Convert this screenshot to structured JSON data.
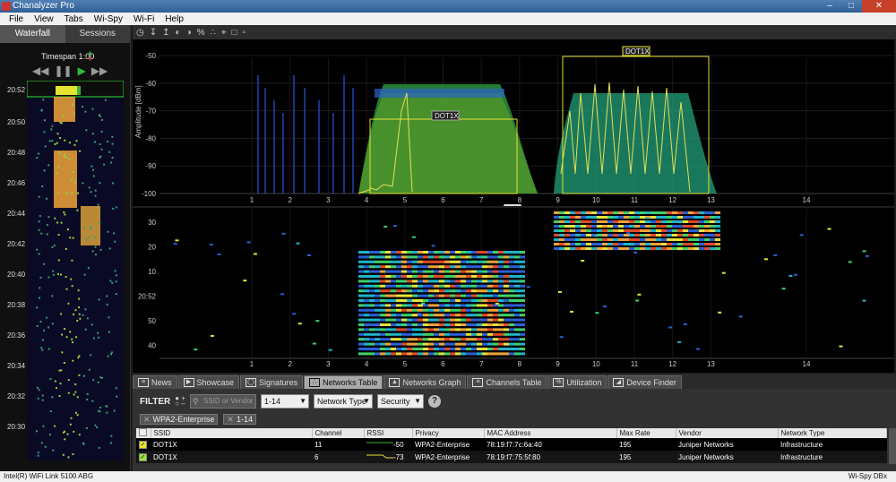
{
  "window": {
    "title": "Chanalyzer Pro"
  },
  "menu": [
    "File",
    "View",
    "Tabs",
    "Wi-Spy",
    "Wi-Fi",
    "Help"
  ],
  "left": {
    "tabs": [
      "Waterfall",
      "Sessions"
    ],
    "timespan": "Timespan 1:00",
    "times": [
      "20:52",
      "20:50",
      "20:48",
      "20:46",
      "20:44",
      "20:42",
      "20:40",
      "20:38",
      "20:36",
      "20:34",
      "20:32",
      "20:30"
    ]
  },
  "spectrum": {
    "ylabel": "Amplitude [dBm]",
    "yticks": [
      "-50",
      "-60",
      "-70",
      "-80",
      "-90",
      "-100"
    ],
    "xticks": [
      "1",
      "2",
      "3",
      "4",
      "5",
      "6",
      "7",
      "8",
      "9",
      "10",
      "11",
      "12",
      "13",
      "14"
    ],
    "networks": [
      {
        "label": "DOT1X"
      },
      {
        "label": "DOT1X"
      }
    ]
  },
  "waterfall": {
    "yticks": [
      "30",
      "20",
      "10",
      "20:52",
      "50",
      "40"
    ],
    "xticks": [
      "1",
      "2",
      "3",
      "4",
      "5",
      "6",
      "7",
      "8",
      "9",
      "10",
      "11",
      "12",
      "13",
      "14"
    ]
  },
  "bottom_tabs": [
    "News",
    "Showcase",
    "Signatures",
    "Networks Table",
    "Networks Graph",
    "Channels Table",
    "Utilization",
    "Device Finder"
  ],
  "filter": {
    "label": "FILTER",
    "search_placeholder": "SSID or Vendor",
    "channel": "1-14",
    "network_type": "Network Type",
    "security": "Security",
    "help": "?",
    "chips": [
      "WPA2-Enterprise",
      "1-14"
    ]
  },
  "table": {
    "columns": [
      "SSID",
      "Channel",
      "RSSI",
      "Privacy",
      "MAC Address",
      "Max Rate",
      "Vendor",
      "Network Type"
    ],
    "rows": [
      {
        "ssid": "DOT1X",
        "channel": "11",
        "rssi": "-50",
        "privacy": "WPA2-Enterprise",
        "mac": "78:19:f7:7c:6a:40",
        "rate": "195",
        "vendor": "Juniper Networks",
        "type": "Infrastructure"
      },
      {
        "ssid": "DOT1X",
        "channel": "6",
        "rssi": "-73",
        "privacy": "WPA2-Enterprise",
        "mac": "78:19:f7:75:5f:80",
        "rate": "195",
        "vendor": "Juniper Networks",
        "type": "Infrastructure"
      }
    ]
  },
  "status": {
    "left": "Intel(R) WiFi Link 5100 ABG",
    "right": "Wi-Spy DBx"
  }
}
